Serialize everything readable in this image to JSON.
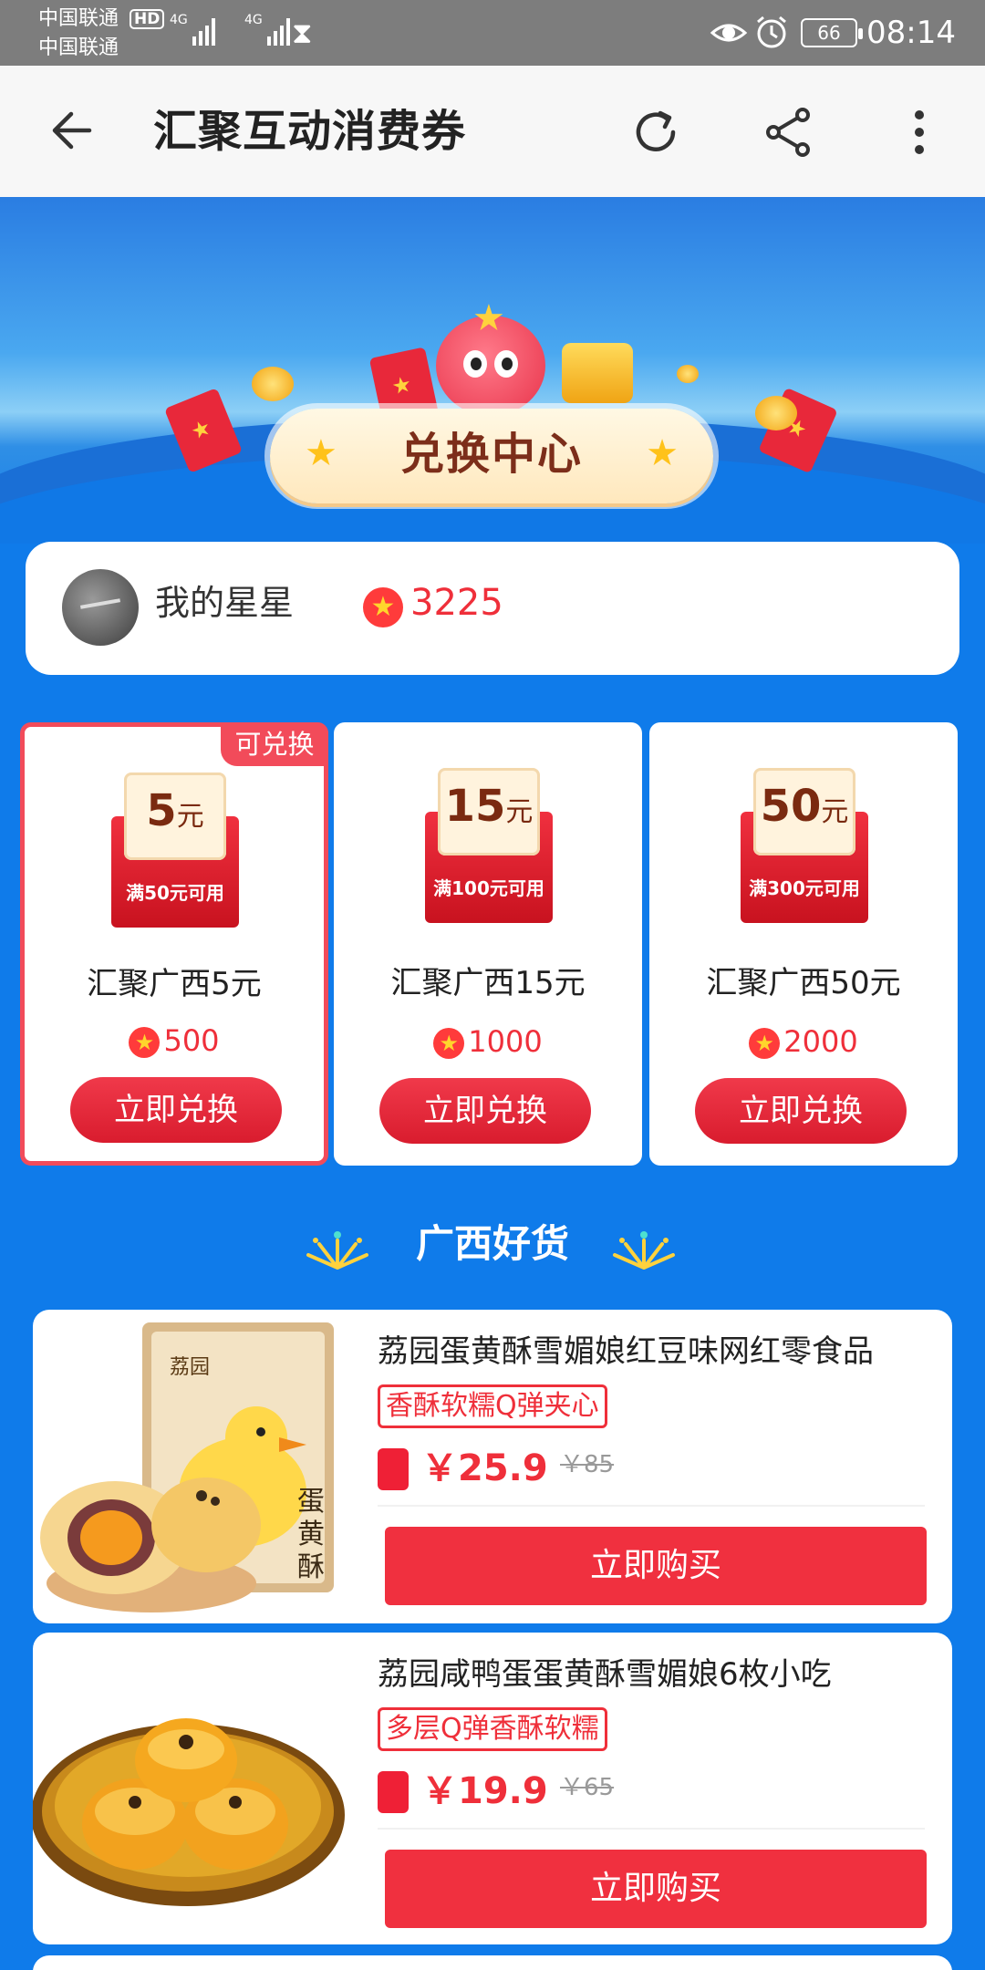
{
  "status_bar": {
    "carrier_1": "中国联通",
    "carrier_2": "中国联通",
    "hd": "HD",
    "net_1": "4G",
    "net_2": "4G",
    "battery": "66",
    "time": "08:14"
  },
  "toolbar": {
    "title": "汇聚互动消费券"
  },
  "banner": {
    "title": "兑换中心"
  },
  "my_stars": {
    "label": "我的星星",
    "value": "3225"
  },
  "coupons": [
    {
      "badge": "可兑换",
      "amount": "5",
      "unit": "元",
      "condition": "满50元可用",
      "name": "汇聚广西5元",
      "price": "500",
      "button": "立即兑换"
    },
    {
      "amount": "15",
      "unit": "元",
      "condition": "满100元可用",
      "name": "汇聚广西15元",
      "price": "1000",
      "button": "立即兑换"
    },
    {
      "amount": "50",
      "unit": "元",
      "condition": "满300元可用",
      "name": "汇聚广西50元",
      "price": "2000",
      "button": "立即兑换"
    }
  ],
  "section": {
    "title": "广西好货"
  },
  "products": [
    {
      "name": "荔园蛋黄酥雪媚娘红豆味网红零食品",
      "tag": "香酥软糯Q弹夹心",
      "price": "￥25.9",
      "old_price": "￥85",
      "button": "立即购买"
    },
    {
      "name": "荔园咸鸭蛋蛋黄酥雪媚娘6枚小吃",
      "tag": "多层Q弹香酥软糯",
      "price": "￥19.9",
      "old_price": "￥65",
      "button": "立即购买"
    }
  ],
  "colors": {
    "accent_red": "#ef2f3a",
    "page_blue": "#0f7bea",
    "star_gold": "#ffd52c"
  }
}
